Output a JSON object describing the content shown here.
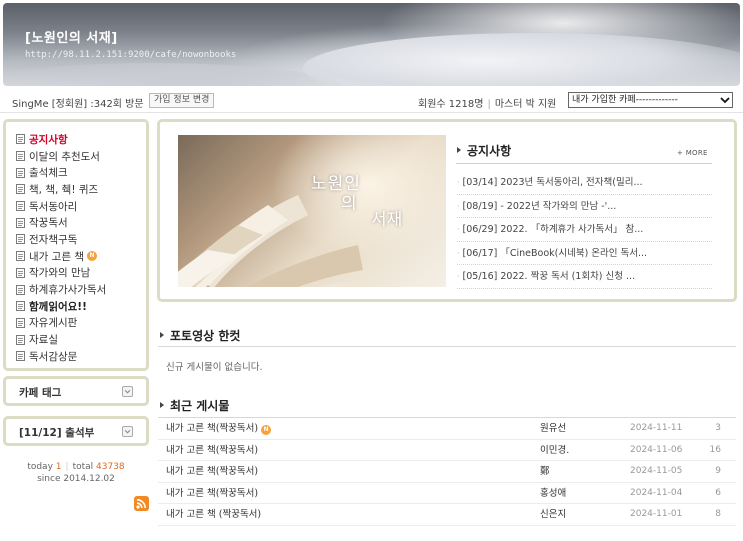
{
  "header": {
    "cafe_title": "[노원인의 서재]",
    "cafe_url": "http://98.11.2.151:9200/cafe/nowonbooks"
  },
  "infobar": {
    "user_text": "SingMe [정회원] :342회 방문",
    "profile_button": "가입 정보 변경",
    "members_text": "회원수 1218명",
    "master_text": "마스터 박 지원",
    "cafe_select": "내가 가입한 카페-------------"
  },
  "menu": {
    "items": [
      {
        "label": "공지사항",
        "style": "active"
      },
      {
        "label": "이달의 추천도서",
        "style": "normal"
      },
      {
        "label": "출석체크",
        "style": "normal"
      },
      {
        "label": "책, 책, 췍! 퀴즈",
        "style": "normal"
      },
      {
        "label": "독서동아리",
        "style": "normal"
      },
      {
        "label": "작꿍독서",
        "style": "normal"
      },
      {
        "label": "전자책구독",
        "style": "normal"
      },
      {
        "label": "내가 고른 책",
        "style": "new"
      },
      {
        "label": "작가와의 만남",
        "style": "normal"
      },
      {
        "label": "하계휴가사가독서",
        "style": "normal"
      },
      {
        "label": "함께읽어요!!",
        "style": "bold"
      },
      {
        "label": "자유게시판",
        "style": "normal"
      },
      {
        "label": "자료실",
        "style": "normal"
      },
      {
        "label": "독서감상문",
        "style": "normal"
      }
    ],
    "new_badge": "N"
  },
  "cafe_tag": {
    "label": "카페 태그"
  },
  "attendance": {
    "label": "[11/12] 출석부"
  },
  "counter": {
    "today_label": "today",
    "today_value": "1",
    "total_label": "total",
    "total_value": "43738",
    "since": "since 2014.12.02"
  },
  "hero": {
    "line1": "노원인",
    "line2": "의",
    "line3": "서재"
  },
  "notice": {
    "title": "공지사항",
    "more": "+ MORE",
    "items": [
      "[03/14] 2023년 독서동아리, 전자책(밀리...",
      "[08/19] - 2022년 작가와의 만남 -'...",
      "[06/29] 2022. 「하계휴가 사가독서」 참...",
      "[06/17] 「CineBook(시네북) 온라인 독서...",
      "[05/16] 2022. 짝꿍 독서 (1회차) 신청 ..."
    ]
  },
  "photo_section": {
    "title": "포토영상 한컷",
    "empty_message": "신규 게시물이 없습니다."
  },
  "recent_section": {
    "title": "최근 게시물",
    "posts": [
      {
        "title": "내가 고른 책(짝꿍독서)",
        "is_new": true,
        "author": "원유선",
        "date": "2024-11-11",
        "views": "3"
      },
      {
        "title": "내가 고른 책(짝꿍독서)",
        "is_new": false,
        "author": "이민경.",
        "date": "2024-11-06",
        "views": "16"
      },
      {
        "title": "내가 고른 책(짝꿍독서)",
        "is_new": false,
        "author": "鄭",
        "date": "2024-11-05",
        "views": "9"
      },
      {
        "title": "내가 고른 책(짝꿍독서)",
        "is_new": false,
        "author": "홍성애",
        "date": "2024-11-04",
        "views": "6"
      },
      {
        "title": "내가 고른 책 (짝꿍독서)",
        "is_new": false,
        "author": "신은지",
        "date": "2024-11-01",
        "views": "8"
      }
    ]
  },
  "colors": {
    "accent_red": "#d6002b",
    "box_border": "#dcdcc4",
    "counter_orange": "#e06a1d",
    "new_badge": "#f6a13a"
  },
  "icons": {
    "menu_item": "document-icon",
    "toggle": "chevron-down-icon",
    "rss": "rss-icon",
    "select": "chevron-down-icon"
  }
}
